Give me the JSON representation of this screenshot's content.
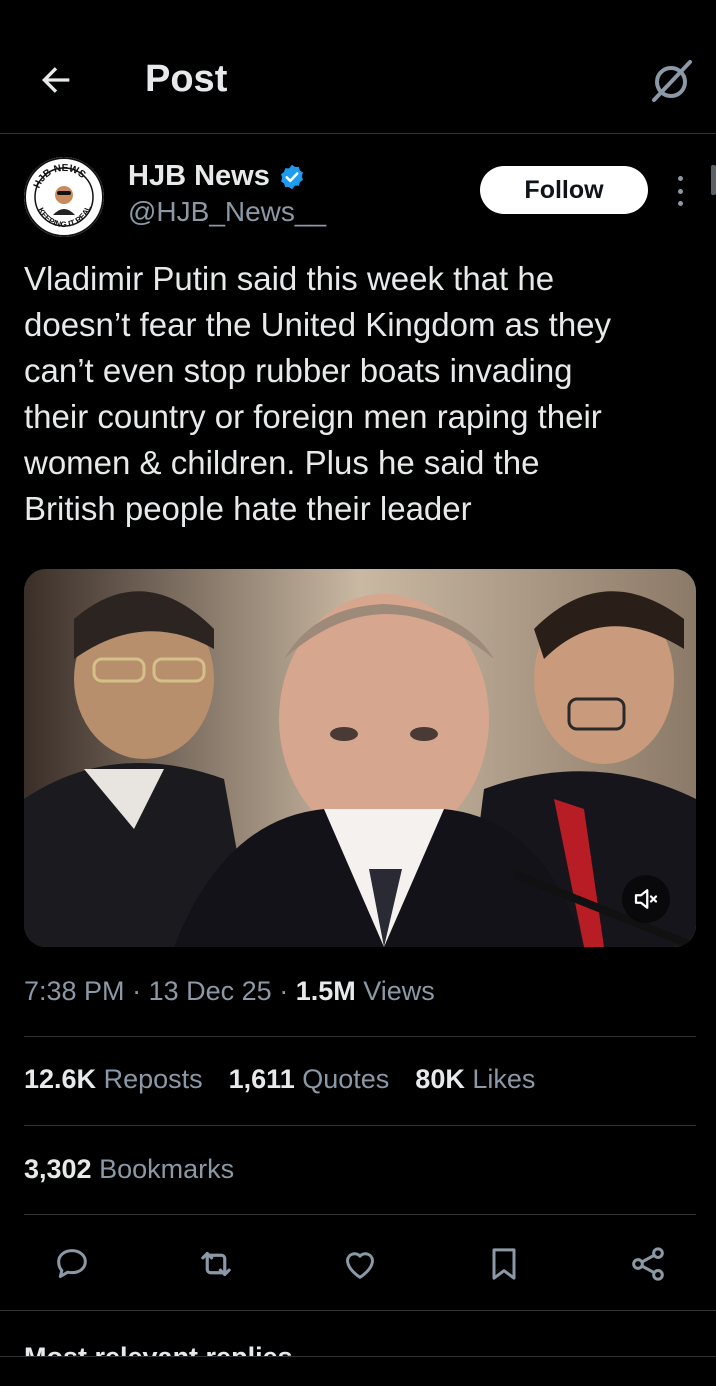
{
  "header": {
    "title": "Post",
    "back_icon": "arrow-left-icon",
    "grok_icon": "grok-icon"
  },
  "author": {
    "name": "HJB News",
    "handle": "@HJB_News__",
    "verified": true,
    "verified_color": "#1d9bf0",
    "avatar_logo_text": [
      "HJB NEWS",
      "KEEPING IT REAL"
    ],
    "follow_label": "Follow"
  },
  "tweet": {
    "text": "Vladimir Putin said this week that he\ndoesn’t fear the United Kingdom as they\ncan’t even stop rubber boats invading\ntheir country or foreign men raping their\nwomen & children. Plus he said the\nBritish people hate their leader"
  },
  "media": {
    "type": "video",
    "mute_icon": "volume-muted-icon"
  },
  "meta": {
    "time": "7:38 PM",
    "sep1": "·",
    "date": "13 Dec 25",
    "sep2": "·",
    "views_count": "1.5M",
    "views_label": "Views"
  },
  "stats": {
    "reposts_count": "12.6K",
    "reposts_label": "Reposts",
    "quotes_count": "1,611",
    "quotes_label": "Quotes",
    "likes_count": "80K",
    "likes_label": "Likes",
    "bookmarks_count": "3,302",
    "bookmarks_label": "Bookmarks"
  },
  "actions": [
    "reply-icon",
    "repost-icon",
    "like-icon",
    "bookmark-icon",
    "share-icon"
  ],
  "replies_sort": {
    "label": "Most relevant replies",
    "icon": "chevron-down-icon"
  },
  "colors": {
    "background": "#000000",
    "text": "#e7e9ea",
    "secondary": "#8b98a5",
    "divider": "#2f3336"
  }
}
